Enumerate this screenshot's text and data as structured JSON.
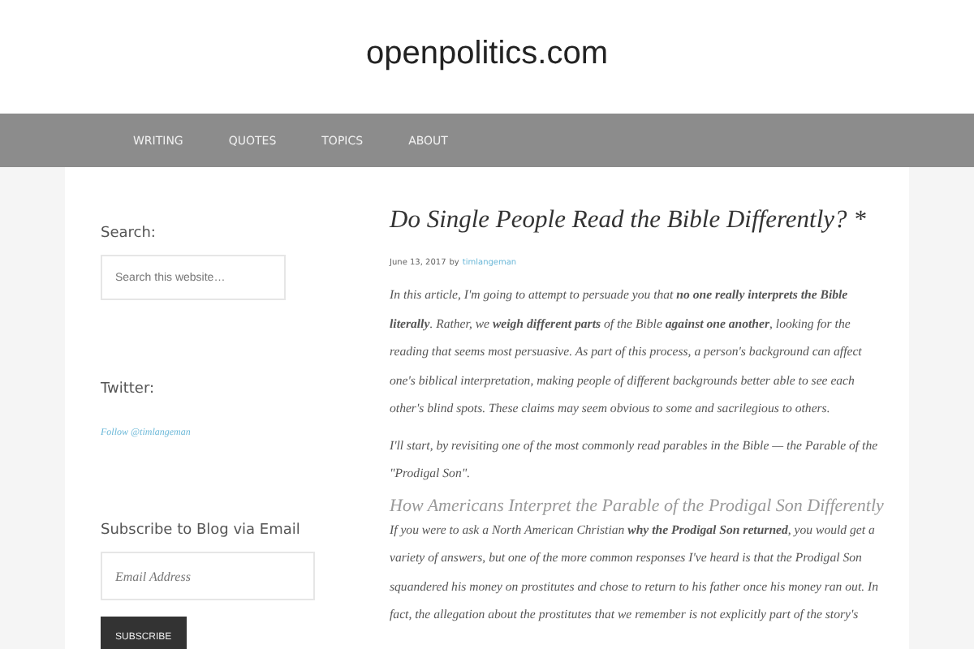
{
  "site_title": "openpolitics.com",
  "nav": [
    {
      "label": "WRITING"
    },
    {
      "label": "QUOTES"
    },
    {
      "label": "TOPICS"
    },
    {
      "label": "ABOUT"
    }
  ],
  "sidebar": {
    "widgets": [
      {
        "kind": "search",
        "title": "Search:",
        "placeholder": "Search this website…"
      },
      {
        "kind": "link",
        "title": "Twitter:",
        "link": "Follow @timlangeman"
      },
      {
        "kind": "subscribe",
        "title": "Subscribe to Blog via Email",
        "placeholder": "Email Address",
        "button": "SUBSCRIBE"
      }
    ]
  },
  "article": {
    "title": "Do Single People Read the Bible Differently? *",
    "date": "June 13, 2017",
    "by": "by",
    "author": "timlangeman",
    "blocks": [
      {
        "kind": "paragraph",
        "text": "In this article, I'm going to attempt to persuade you that **no one really interprets the Bible literally**.  Rather, we **weigh different parts** of the Bible **against one another**, looking for the reading that seems most persuasive.  As part of this process, a person's background can affect one's biblical interpretation, making people of different backgrounds better able to see each other's blind spots.  These claims may seem obvious to some and sacrilegious to others."
      },
      {
        "kind": "paragraph",
        "text": "I'll start, by revisiting one of the most commonly read parables in the Bible — the Parable of the \"Prodigal Son\"."
      },
      {
        "kind": "heading",
        "text": "How Americans Interpret the Parable of the Prodigal Son  Differently"
      },
      {
        "kind": "paragraph",
        "text": "If you were to ask a North American Christian **why the Prodigal Son returned**, you would get a variety of answers, but one of the more common responses I've heard is that the Prodigal Son squandered his money on prostitutes and chose to return to his father once his money ran out.  In fact, the allegation about the prostitutes that we remember is not explicitly part of the story's"
      }
    ]
  }
}
